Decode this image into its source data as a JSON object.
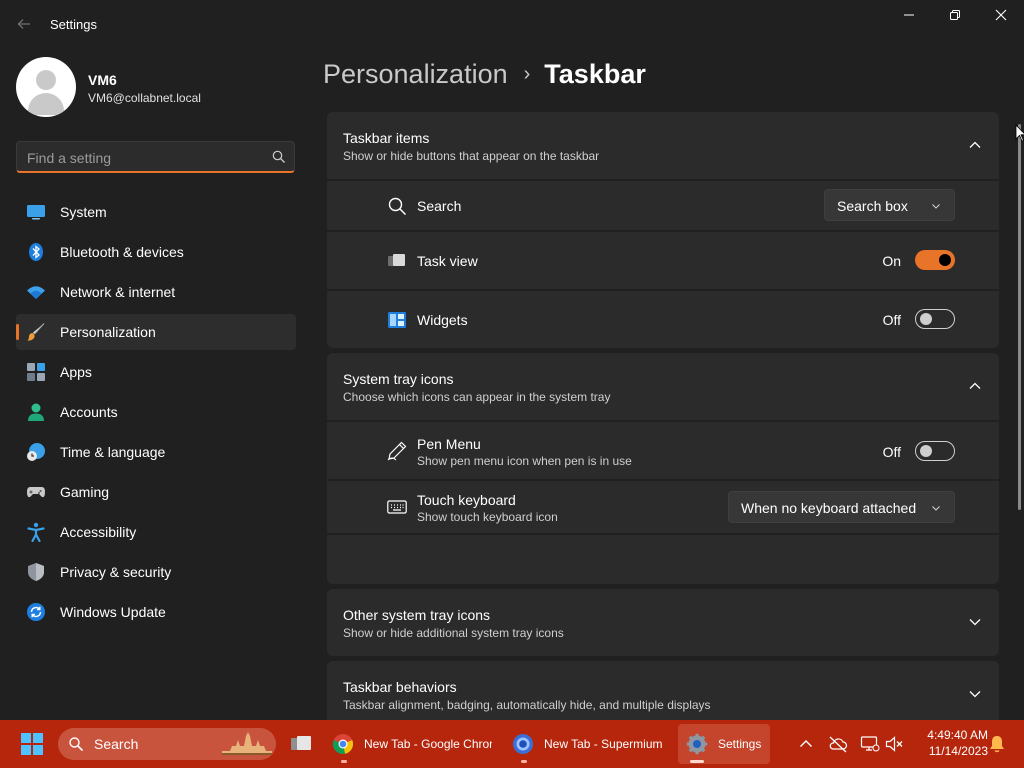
{
  "window": {
    "title": "Settings",
    "back_icon": "back-arrow-icon",
    "controls": [
      "minimize-icon",
      "maximize-icon",
      "close-icon"
    ]
  },
  "profile": {
    "name": "VM6",
    "email": "VM6@collabnet.local"
  },
  "search": {
    "placeholder": "Find a setting"
  },
  "sidebar": {
    "items": [
      {
        "label": "System",
        "icon": "system-icon",
        "selected": false
      },
      {
        "label": "Bluetooth & devices",
        "icon": "bluetooth-icon",
        "selected": false
      },
      {
        "label": "Network & internet",
        "icon": "wifi-icon",
        "selected": false
      },
      {
        "label": "Personalization",
        "icon": "brush-icon",
        "selected": true
      },
      {
        "label": "Apps",
        "icon": "apps-icon",
        "selected": false
      },
      {
        "label": "Accounts",
        "icon": "person-icon",
        "selected": false
      },
      {
        "label": "Time & language",
        "icon": "clock-globe-icon",
        "selected": false
      },
      {
        "label": "Gaming",
        "icon": "gamepad-icon",
        "selected": false
      },
      {
        "label": "Accessibility",
        "icon": "accessibility-icon",
        "selected": false
      },
      {
        "label": "Privacy & security",
        "icon": "shield-icon",
        "selected": false
      },
      {
        "label": "Windows Update",
        "icon": "update-icon",
        "selected": false
      }
    ]
  },
  "breadcrumb": {
    "parent": "Personalization",
    "separator": "›",
    "current": "Taskbar"
  },
  "sections": {
    "taskbar_items": {
      "title": "Taskbar items",
      "description": "Show or hide buttons that appear on the taskbar",
      "expanded": true,
      "rows": {
        "search": {
          "label": "Search",
          "value": "Search box"
        },
        "task_view": {
          "label": "Task view",
          "state": "On"
        },
        "widgets": {
          "label": "Widgets",
          "state": "Off"
        }
      }
    },
    "system_tray_icons": {
      "title": "System tray icons",
      "description": "Choose which icons can appear in the system tray",
      "expanded": true,
      "rows": {
        "pen_menu": {
          "label": "Pen Menu",
          "description": "Show pen menu icon when pen is in use",
          "state": "Off"
        },
        "touch_keyboard": {
          "label": "Touch keyboard",
          "description": "Show touch keyboard icon",
          "value": "When no keyboard attached"
        }
      }
    },
    "other_tray_icons": {
      "title": "Other system tray icons",
      "description": "Show or hide additional system tray icons",
      "expanded": false
    },
    "taskbar_behaviors": {
      "title": "Taskbar behaviors",
      "description": "Taskbar alignment, badging, automatically hide, and multiple displays",
      "expanded": false
    }
  },
  "colors": {
    "accent": "#e8742a",
    "background": "#202020",
    "card": "#2b2b2b",
    "taskbar": "#b5260d"
  },
  "taskbar": {
    "search_label": "Search",
    "apps": [
      {
        "label": "",
        "icon": "task-view-icon",
        "active": false
      },
      {
        "label": "New Tab - Google Chrome",
        "icon": "chrome-icon",
        "active": false
      },
      {
        "label": "New Tab - Supermium",
        "icon": "supermium-icon",
        "active": false
      },
      {
        "label": "Settings",
        "icon": "settings-gear-icon",
        "active": true
      }
    ],
    "tray_icons": [
      "chevron-up-icon",
      "cloud-off-icon",
      "display-icon",
      "volume-muted-icon",
      "notification-bell-icon"
    ],
    "time": "4:49:40 AM",
    "date": "11/14/2023"
  }
}
